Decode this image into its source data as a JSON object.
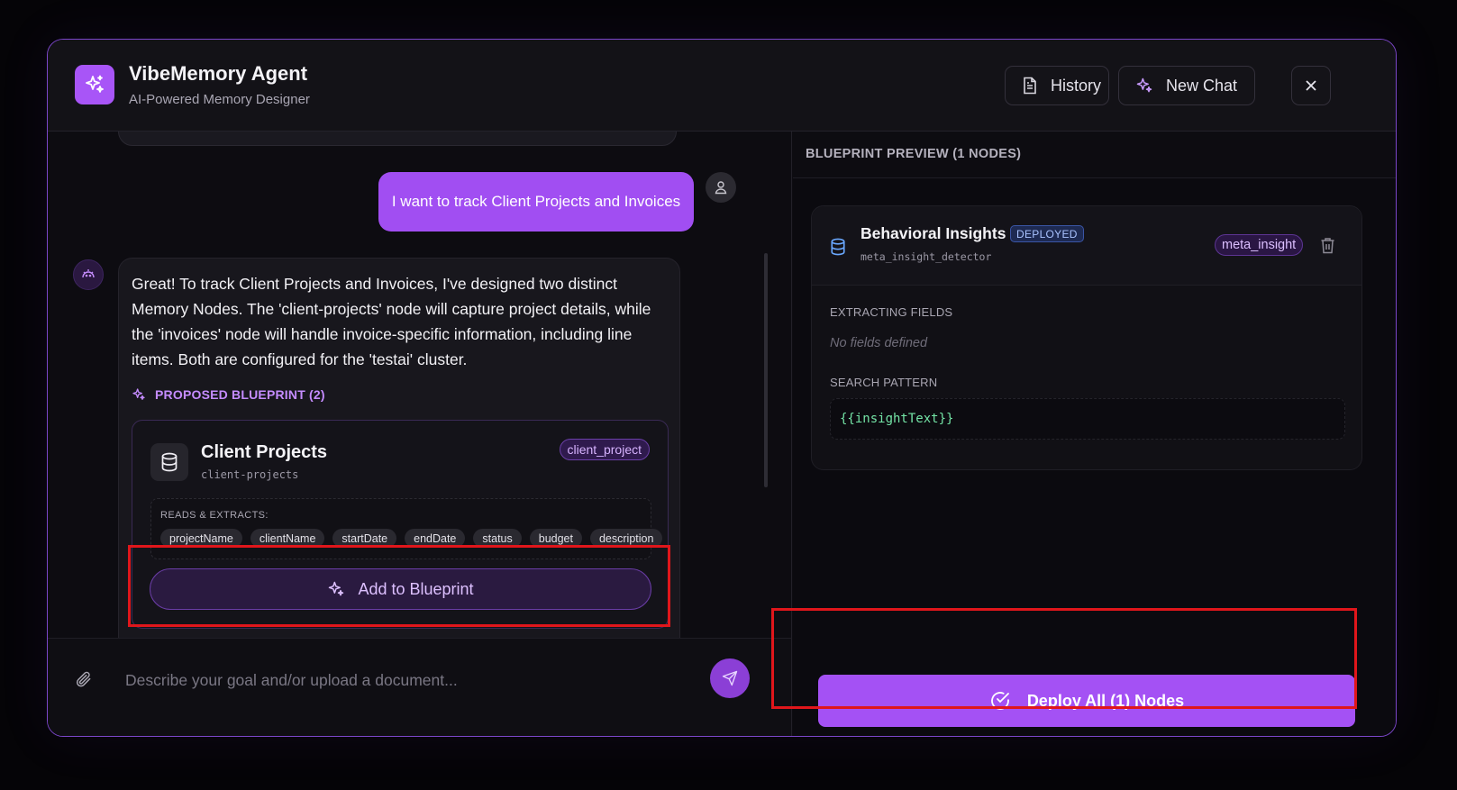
{
  "header": {
    "title": "VibeMemory Agent",
    "subtitle": "AI-Powered Memory Designer",
    "history_label": "History",
    "new_chat_label": "New Chat"
  },
  "chat": {
    "user_message": "I want to track Client Projects and Invoices",
    "assistant_message": "Great! To track Client Projects and Invoices, I've designed two distinct Memory Nodes. The 'client-projects' node will capture project details, while the 'invoices' node will handle invoice-specific information, including line items. Both are configured for the 'testai' cluster.",
    "proposed_label": "PROPOSED BLUEPRINT (2)",
    "proposal": {
      "title": "Client Projects",
      "slug": "client-projects",
      "tag": "client_project",
      "extract_label": "READS & EXTRACTS:",
      "fields": [
        "projectName",
        "clientName",
        "startDate",
        "endDate",
        "status",
        "budget",
        "description"
      ],
      "add_label": "Add to Blueprint"
    },
    "input_placeholder": "Describe your goal and/or upload a document..."
  },
  "blueprint": {
    "header": "BLUEPRINT PREVIEW (1 NODES)",
    "node": {
      "title": "Behavioral Insights",
      "status": "DEPLOYED",
      "slug": "meta_insight_detector",
      "tag": "meta_insight",
      "fields_label": "EXTRACTING FIELDS",
      "no_fields": "No fields defined",
      "pattern_label": "SEARCH PATTERN",
      "pattern": "{{insightText}}"
    },
    "deploy_label": "Deploy All (1) Nodes"
  },
  "colors": {
    "accent": "#a855f7",
    "highlight": "#e0161b",
    "pattern_text": "#74e4a6"
  }
}
